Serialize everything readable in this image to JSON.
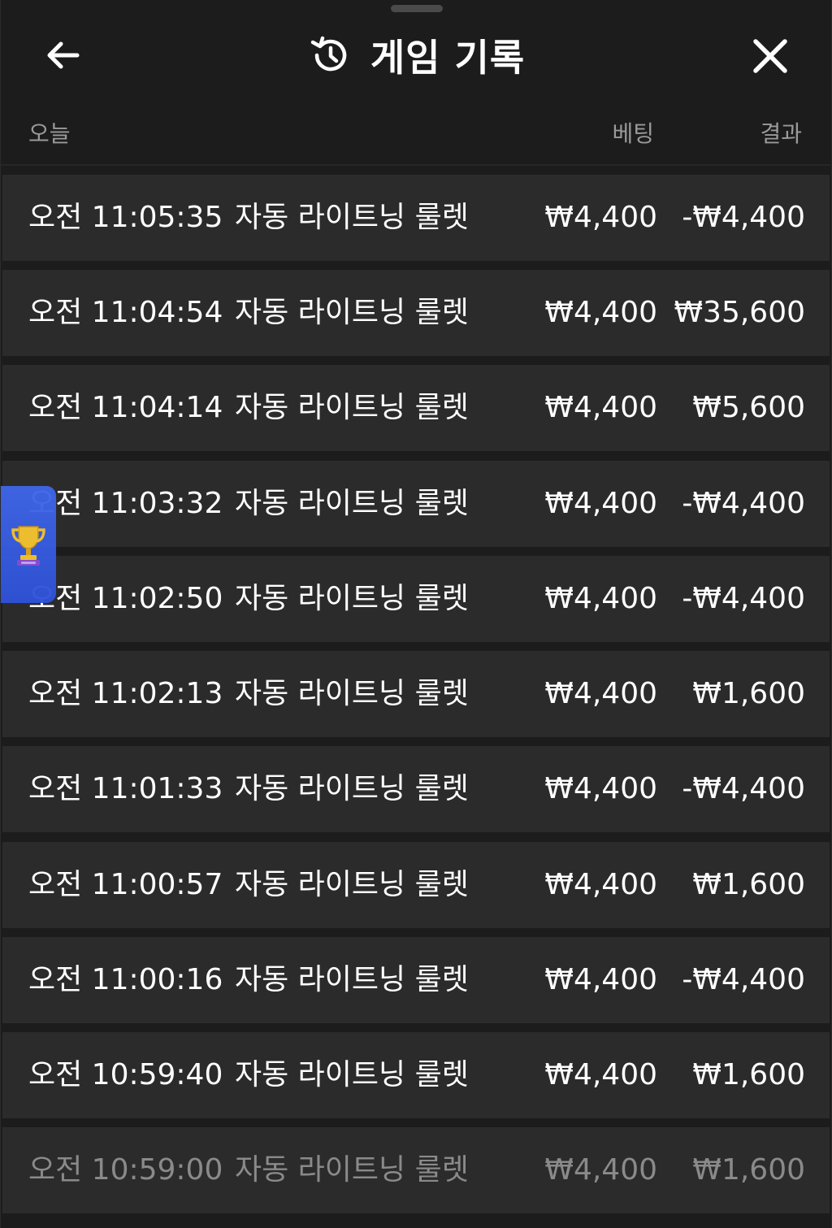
{
  "header": {
    "title": "게임 기록",
    "back_icon": "arrow-left-icon",
    "history_icon": "history-clock-icon",
    "close_icon": "close-icon"
  },
  "columns": {
    "date_label": "오늘",
    "bet_label": "베팅",
    "result_label": "결과"
  },
  "rows": [
    {
      "time": "오전 11:05:35",
      "game": "자동 라이트닝 룰렛",
      "bet": "₩4,400",
      "result": "-₩4,400"
    },
    {
      "time": "오전 11:04:54",
      "game": "자동 라이트닝 룰렛",
      "bet": "₩4,400",
      "result": "₩35,600"
    },
    {
      "time": "오전 11:04:14",
      "game": "자동 라이트닝 룰렛",
      "bet": "₩4,400",
      "result": "₩5,600"
    },
    {
      "time": "오전 11:03:32",
      "game": "자동 라이트닝 룰렛",
      "bet": "₩4,400",
      "result": "-₩4,400"
    },
    {
      "time": "오전 11:02:50",
      "game": "자동 라이트닝 룰렛",
      "bet": "₩4,400",
      "result": "-₩4,400"
    },
    {
      "time": "오전 11:02:13",
      "game": "자동 라이트닝 룰렛",
      "bet": "₩4,400",
      "result": "₩1,600"
    },
    {
      "time": "오전 11:01:33",
      "game": "자동 라이트닝 룰렛",
      "bet": "₩4,400",
      "result": "-₩4,400"
    },
    {
      "time": "오전 11:00:57",
      "game": "자동 라이트닝 룰렛",
      "bet": "₩4,400",
      "result": "₩1,600"
    },
    {
      "time": "오전 11:00:16",
      "game": "자동 라이트닝 룰렛",
      "bet": "₩4,400",
      "result": "-₩4,400"
    },
    {
      "time": "오전 10:59:40",
      "game": "자동 라이트닝 룰렛",
      "bet": "₩4,400",
      "result": "₩1,600"
    },
    {
      "time": "오전 10:59:00",
      "game": "자동 라이트닝 룰렛",
      "bet": "₩4,400",
      "result": "₩1,600"
    }
  ],
  "floating_tab": {
    "icon": "trophy-icon",
    "color": "#3a5fe5"
  },
  "colors": {
    "background": "#1c1c1c",
    "row_background": "#2b2b2b",
    "muted_text": "#9a9a9a"
  }
}
